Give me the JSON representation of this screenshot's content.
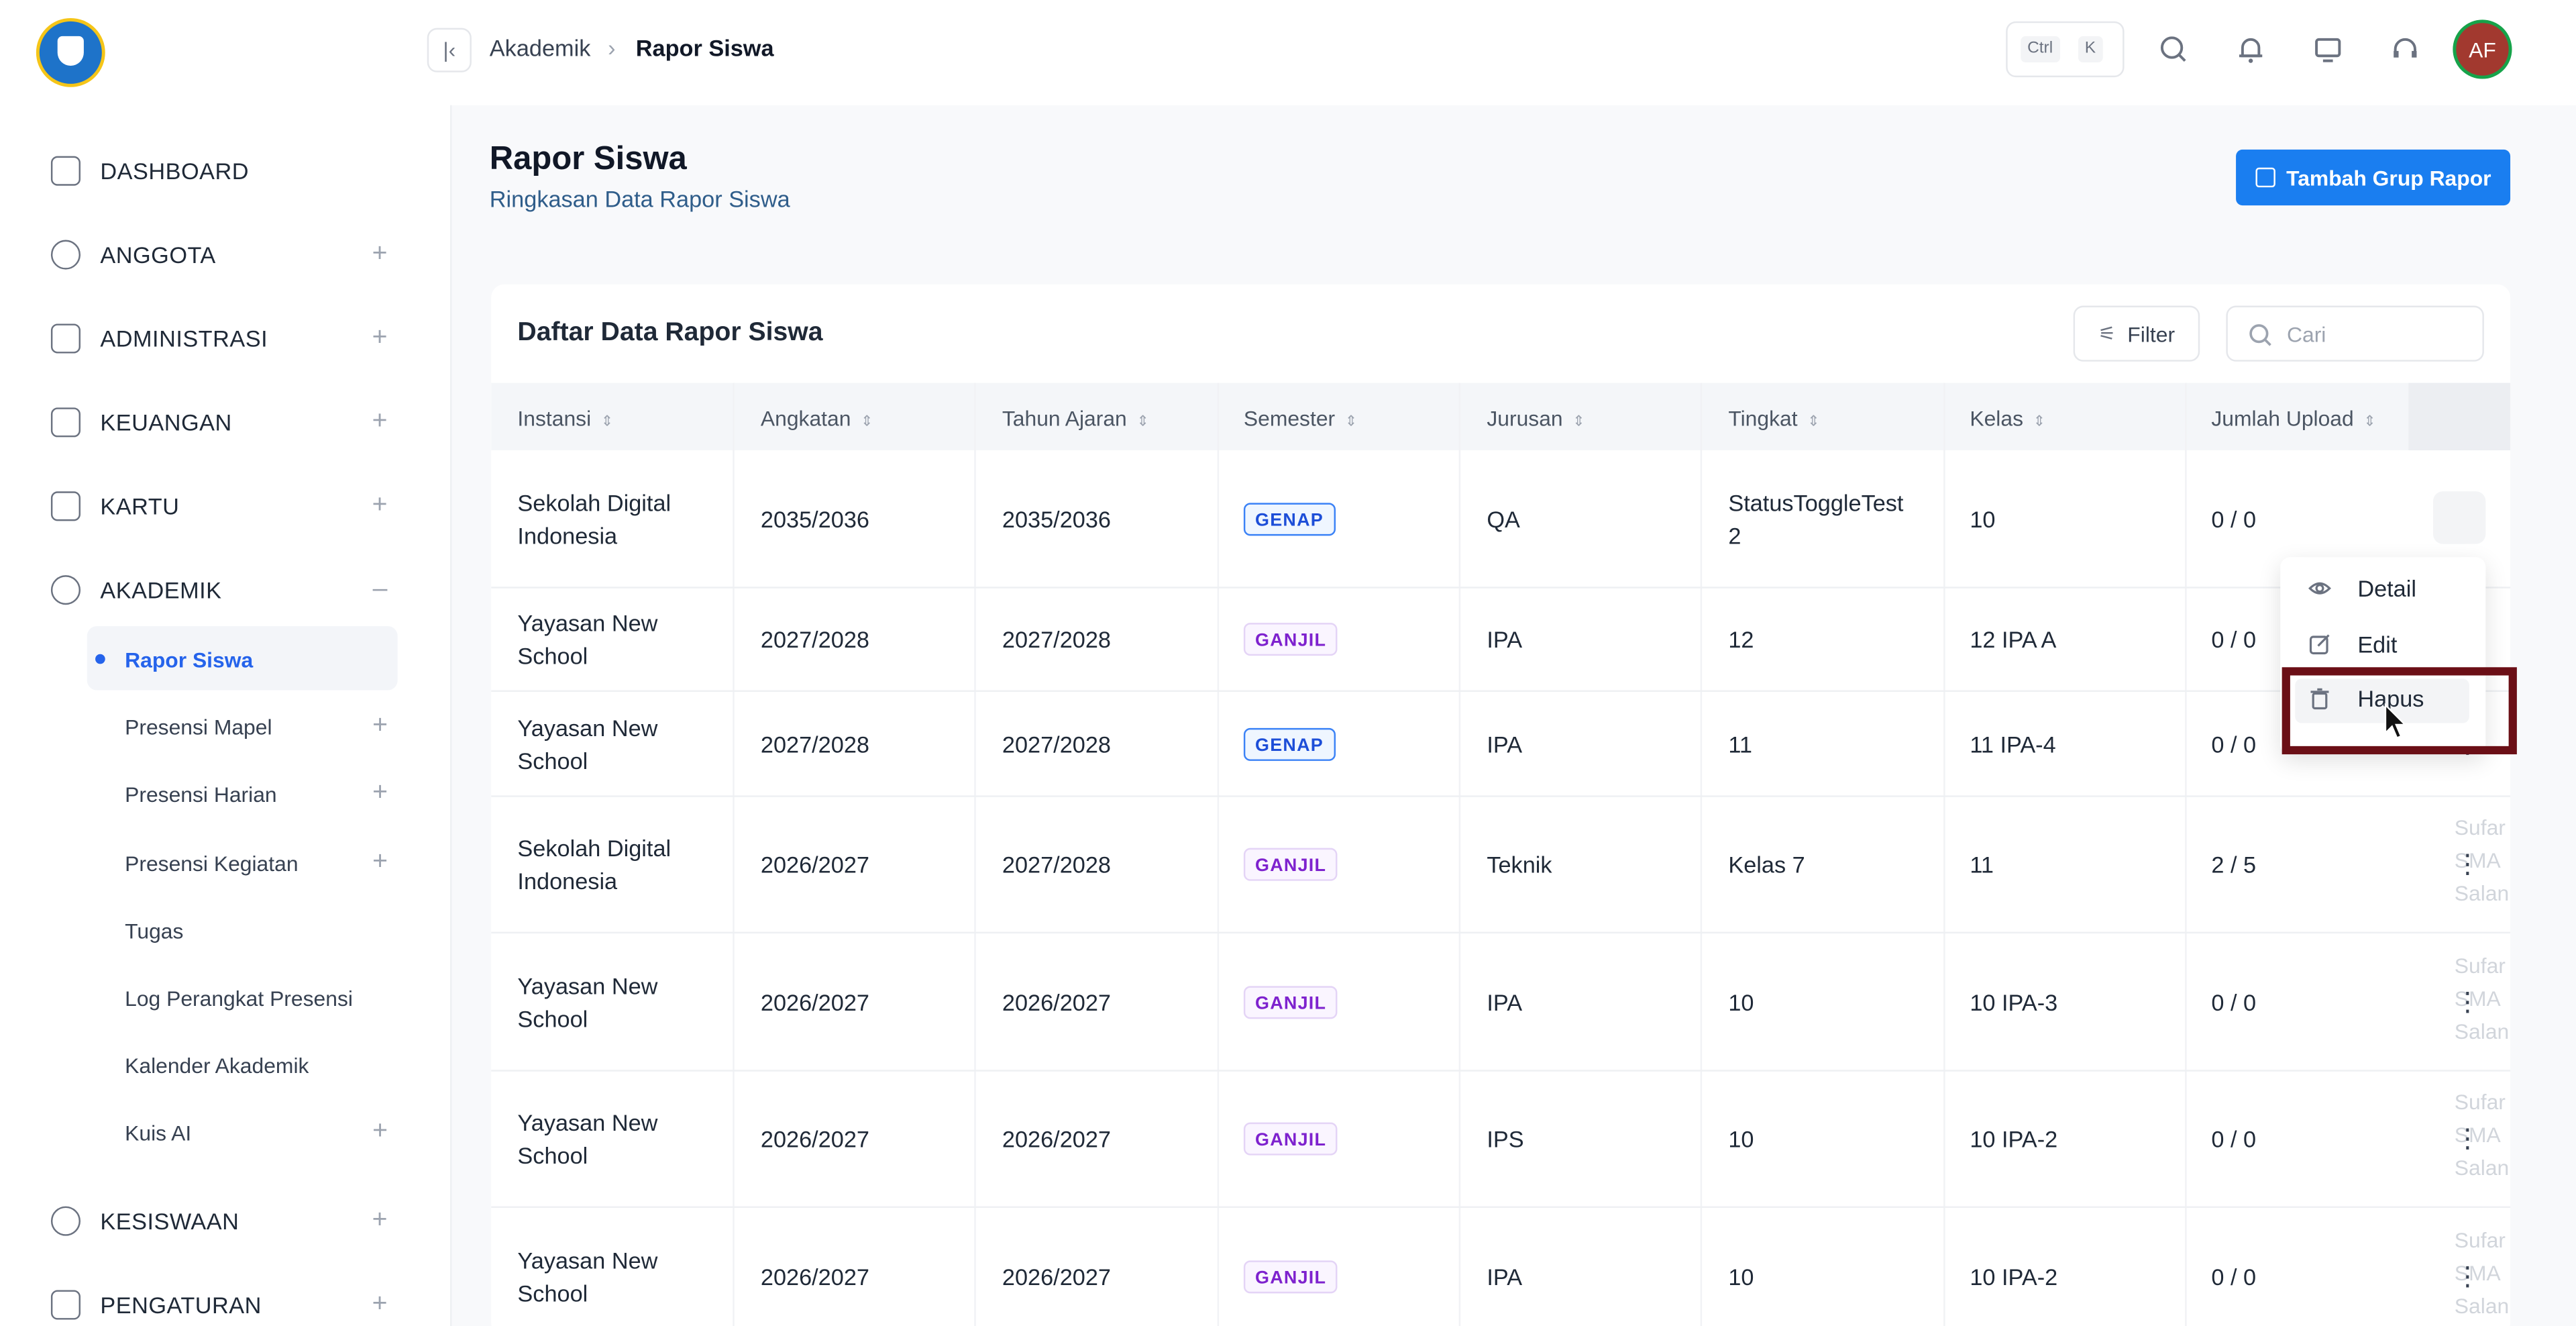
{
  "breadcrumb": {
    "parent": "Akademik",
    "current": "Rapor Siswa"
  },
  "topbar": {
    "kbd_ctrl": "Ctrl",
    "kbd_k": "K",
    "avatar_initials": "AF",
    "icons": [
      "search-icon",
      "bell-icon",
      "monitor-icon",
      "headset-icon"
    ]
  },
  "sidebar": {
    "items": [
      {
        "label": "DASHBOARD",
        "icon": "dashboard-icon",
        "expandable": false
      },
      {
        "label": "ANGGOTA",
        "icon": "users-icon",
        "expandable": true
      },
      {
        "label": "ADMINISTRASI",
        "icon": "folder-icon",
        "expandable": true
      },
      {
        "label": "KEUANGAN",
        "icon": "wallet-icon",
        "expandable": true
      },
      {
        "label": "KARTU",
        "icon": "card-icon",
        "expandable": true
      },
      {
        "label": "AKADEMIK",
        "icon": "academic-icon",
        "expandable": true,
        "expanded": true
      },
      {
        "label": "KESISWAAN",
        "icon": "student-icon",
        "expandable": true
      },
      {
        "label": "PENGATURAN",
        "icon": "settings-icon",
        "expandable": true
      }
    ],
    "subitems": [
      {
        "label": "Rapor Siswa",
        "active": true
      },
      {
        "label": "Presensi Mapel",
        "expandable": true
      },
      {
        "label": "Presensi Harian",
        "expandable": true
      },
      {
        "label": "Presensi Kegiatan",
        "expandable": true
      },
      {
        "label": "Tugas"
      },
      {
        "label": "Log Perangkat Presensi"
      },
      {
        "label": "Kalender Akademik"
      },
      {
        "label": "Kuis AI",
        "expandable": true
      }
    ]
  },
  "page": {
    "title": "Rapor Siswa",
    "subtitle": "Ringkasan Data Rapor Siswa",
    "add_button": "Tambah Grup Rapor"
  },
  "table": {
    "title": "Daftar Data Rapor Siswa",
    "filter_label": "Filter",
    "search_placeholder": "Cari",
    "columns": [
      "Instansi",
      "Angkatan",
      "Tahun Ajaran",
      "Semester",
      "Jurusan",
      "Tingkat",
      "Kelas",
      "Jumlah Upload"
    ],
    "rows": [
      {
        "instansi": [
          "Sekolah Digital",
          "Indonesia"
        ],
        "angkatan": "2035/2036",
        "tahun": "2035/2036",
        "semester": "GENAP",
        "jurusan": "QA",
        "tingkat": [
          "StatusToggleTest",
          "2"
        ],
        "kelas": "10",
        "upload": "0 / 0"
      },
      {
        "instansi": [
          "Yayasan New",
          "School"
        ],
        "angkatan": "2027/2028",
        "tahun": "2027/2028",
        "semester": "GANJIL",
        "jurusan": "IPA",
        "tingkat": [
          "12"
        ],
        "kelas": "12 IPA A",
        "upload": "0 / 0"
      },
      {
        "instansi": [
          "Yayasan New",
          "School"
        ],
        "angkatan": "2027/2028",
        "tahun": "2027/2028",
        "semester": "GENAP",
        "jurusan": "IPA",
        "tingkat": [
          "11"
        ],
        "kelas": "11 IPA-4",
        "upload": "0 / 0"
      },
      {
        "instansi": [
          "Sekolah Digital",
          "Indonesia"
        ],
        "angkatan": "2026/2027",
        "tahun": "2027/2028",
        "semester": "GANJIL",
        "jurusan": "Teknik",
        "tingkat": [
          "Kelas 7"
        ],
        "kelas": "11",
        "upload": "2 / 5"
      },
      {
        "instansi": [
          "Yayasan New",
          "School"
        ],
        "angkatan": "2026/2027",
        "tahun": "2026/2027",
        "semester": "GANJIL",
        "jurusan": "IPA",
        "tingkat": [
          "10"
        ],
        "kelas": "10 IPA-3",
        "upload": "0 / 0"
      },
      {
        "instansi": [
          "Yayasan New",
          "School"
        ],
        "angkatan": "2026/2027",
        "tahun": "2026/2027",
        "semester": "GANJIL",
        "jurusan": "IPS",
        "tingkat": [
          "10"
        ],
        "kelas": "10 IPA-2",
        "upload": "0 / 0"
      },
      {
        "instansi": [
          "Yayasan New",
          "School"
        ],
        "angkatan": "2026/2027",
        "tahun": "2026/2027",
        "semester": "GANJIL",
        "jurusan": "IPA",
        "tingkat": [
          "10"
        ],
        "kelas": "10 IPA-2",
        "upload": "0 / 0"
      }
    ],
    "truncated_column_text": [
      "Sufar",
      "SMA",
      "Salan"
    ]
  },
  "context_menu": {
    "items": [
      "Detail",
      "Edit",
      "Hapus"
    ],
    "hovered": "Hapus"
  },
  "colors": {
    "primary": "#1a7ef0",
    "highlight_border": "#6b0f16",
    "genap": "#1d4ed8",
    "ganjil": "#7e22ce"
  }
}
